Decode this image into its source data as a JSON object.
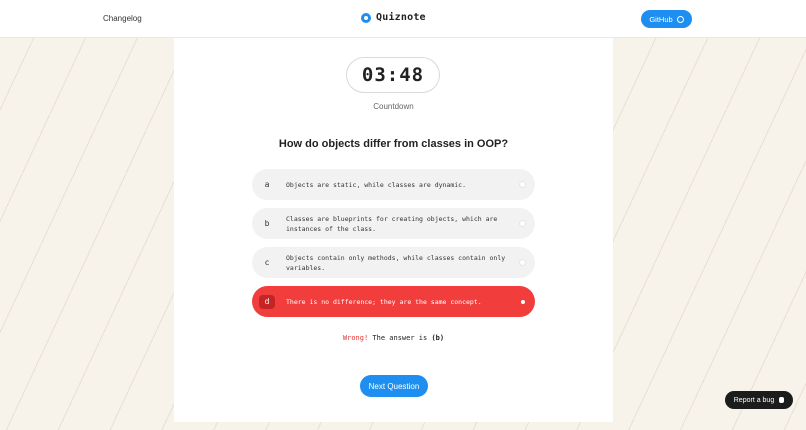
{
  "header": {
    "changelog_label": "Changelog",
    "brand_name": "Quiznote",
    "github_label": "GitHub"
  },
  "quiz": {
    "timer": "03:48",
    "timer_label": "Countdown",
    "question": "How do objects differ from classes in OOP?",
    "options": [
      {
        "letter": "a",
        "text": "Objects are static, while classes are dynamic."
      },
      {
        "letter": "b",
        "text": "Classes are blueprints for creating objects, which are instances of the class."
      },
      {
        "letter": "c",
        "text": "Objects contain only methods, while classes contain only variables."
      },
      {
        "letter": "d",
        "text": "There is no difference; they are the same concept."
      }
    ],
    "selected_option": "d",
    "feedback": {
      "status": "Wrong!",
      "message": "The answer is",
      "answer": "(b)"
    },
    "next_label": "Next Question"
  },
  "footer": {
    "report_bug_label": "Report a bug"
  },
  "colors": {
    "accent": "#1e8ff0",
    "wrong": "#f23d3d",
    "background": "#f7f3ea"
  }
}
